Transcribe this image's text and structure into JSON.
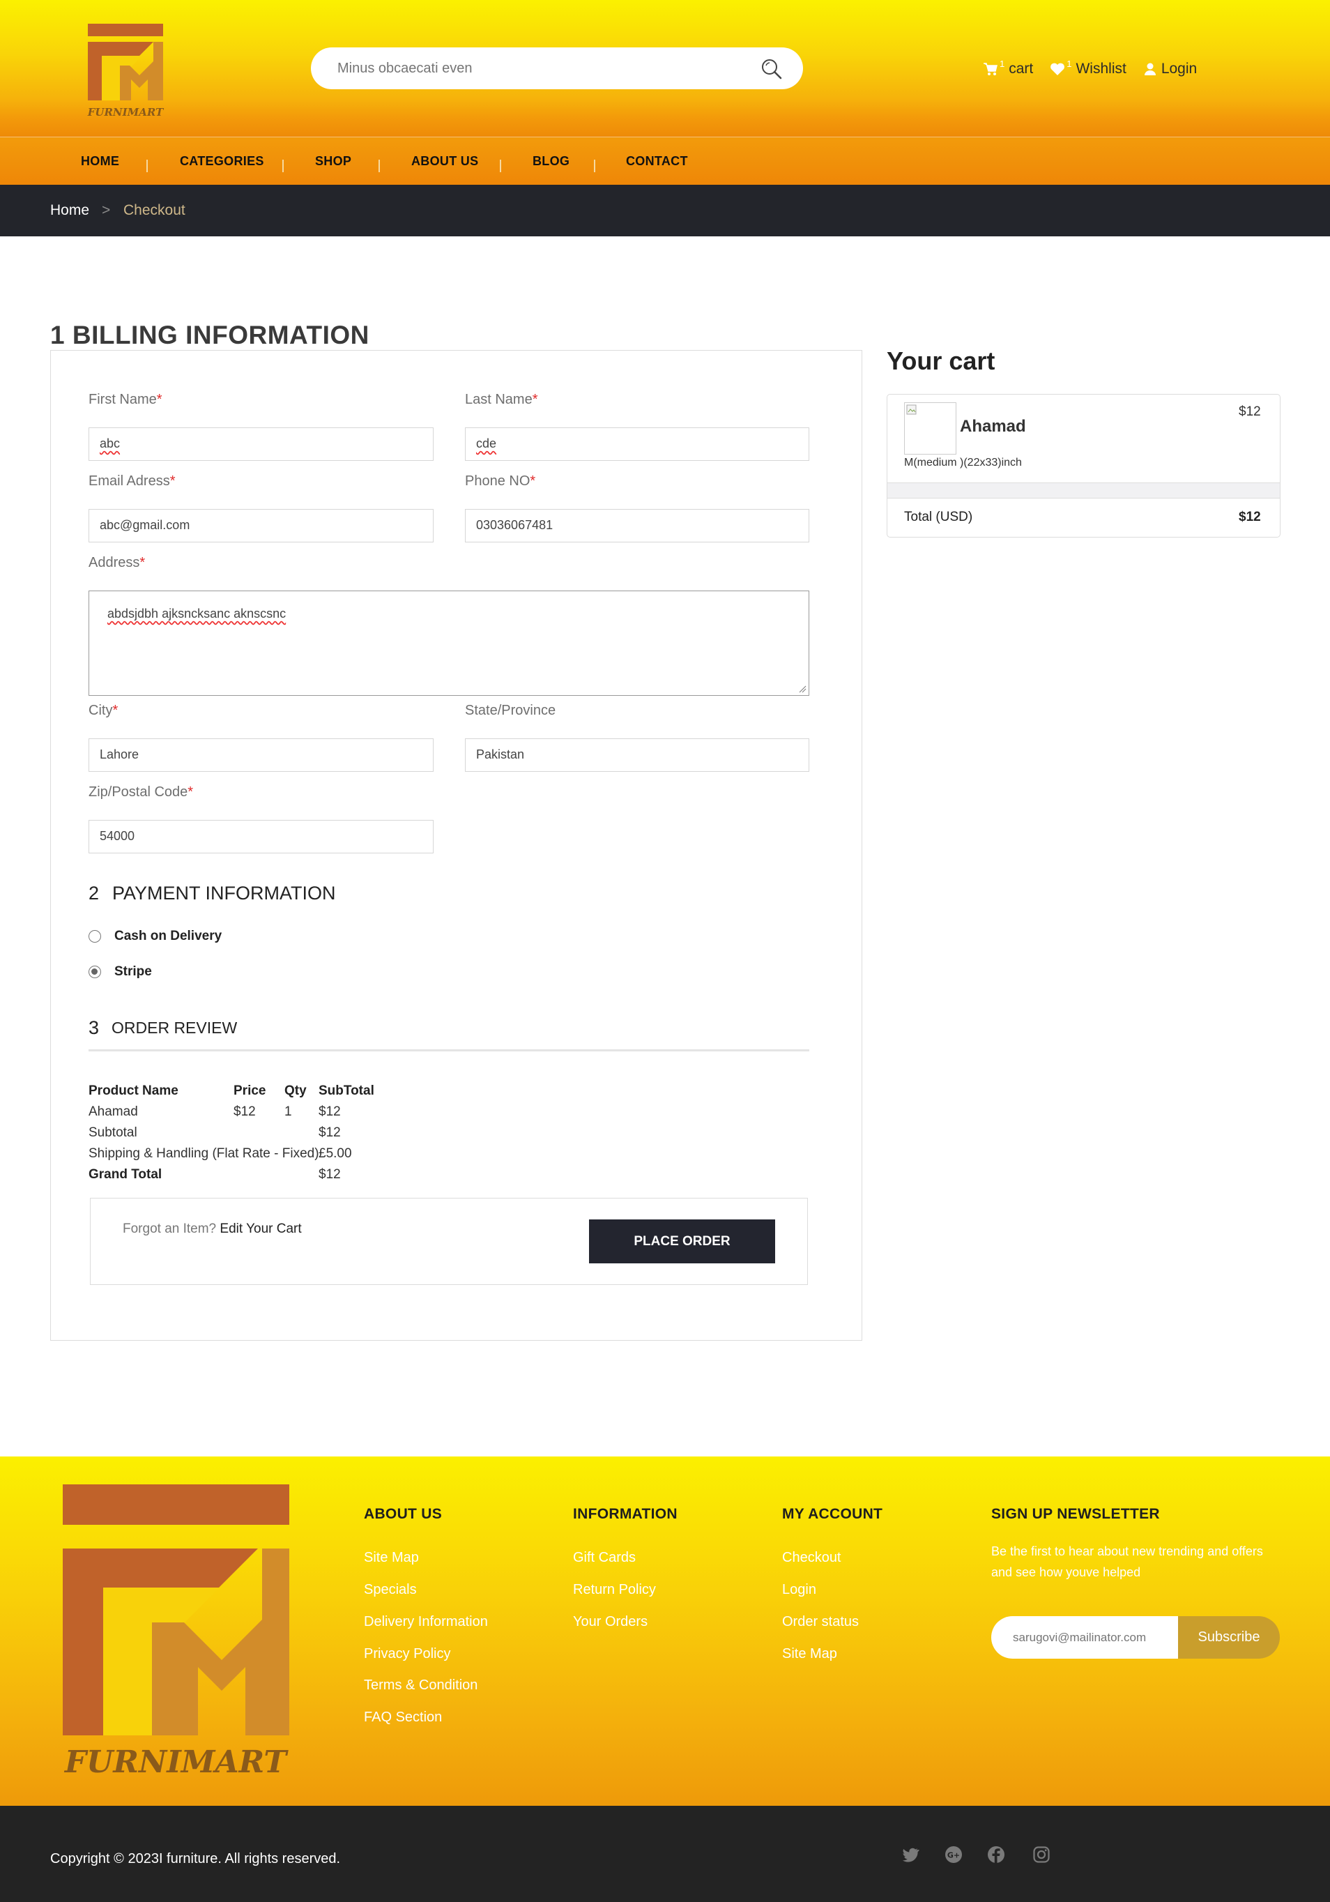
{
  "brand": {
    "name": "FURNIMART",
    "colors": {
      "accent_yellow": "#fbf100",
      "accent_orange": "#ef8708",
      "logo_brown": "#c0622a",
      "logo_gold": "#d28c2a",
      "dark": "#23252b"
    }
  },
  "header": {
    "search": {
      "placeholder": "Minus obcaecati even",
      "icon": "search-icon"
    },
    "cart": {
      "label": "cart",
      "count": "1"
    },
    "wishlist": {
      "label": "Wishlist",
      "count": "1"
    },
    "login": {
      "label": "Login"
    }
  },
  "nav": {
    "items": [
      "HOME",
      "CATEGORIES",
      "SHOP",
      "ABOUT US",
      "BLOG",
      "CONTACT"
    ]
  },
  "breadcrumb": {
    "home": "Home",
    "sep": ">",
    "current": "Checkout"
  },
  "billing": {
    "title": "1 BILLING INFORMATION",
    "required_mark": "*",
    "fields": {
      "first_name": {
        "label": "First Name",
        "value": "abc"
      },
      "last_name": {
        "label": "Last Name",
        "value": "cde"
      },
      "email": {
        "label": "Email Adress",
        "value": "abc@gmail.com"
      },
      "phone": {
        "label": "Phone NO",
        "value": "03036067481"
      },
      "address": {
        "label": "Address",
        "value": "abdsjdbh ajksncksanc aknscsnc"
      },
      "city": {
        "label": "City",
        "value": "Lahore"
      },
      "state": {
        "label": "State/Province",
        "value": "Pakistan"
      },
      "zip": {
        "label": "Zip/Postal Code",
        "value": "54000"
      }
    }
  },
  "payment": {
    "num": "2",
    "title": "PAYMENT INFORMATION",
    "options": [
      {
        "label": "Cash on Delivery",
        "selected": false
      },
      {
        "label": "Stripe",
        "selected": true
      }
    ]
  },
  "review": {
    "num": "3",
    "title": "ORDER REVIEW",
    "headers": [
      "Product Name",
      "Price",
      "Qty",
      "SubTotal"
    ],
    "row": {
      "name": "Ahamad",
      "price": "$12",
      "qty": "1",
      "subtotal": "$12"
    },
    "subtotal_label": "Subtotal",
    "subtotal_value": "$12",
    "shipping_label": "Shipping & Handling (Flat Rate - Fixed)",
    "shipping_value": "£5.00",
    "grand_label": "Grand Total",
    "grand_value": "$12",
    "forgot_text": "Forgot an Item?",
    "edit_cart": "Edit Your Cart",
    "place_order": "PLACE ORDER"
  },
  "cart": {
    "title": "Your cart",
    "item": {
      "name": "Ahamad",
      "price": "$12",
      "variant": "M(medium )(22x33)inch"
    },
    "total_label": "Total (USD)",
    "total_value": "$12"
  },
  "footer": {
    "about": {
      "title": "ABOUT US",
      "links": [
        "Site Map",
        "Specials",
        "Delivery Information",
        "Privacy Policy",
        "Terms & Condition",
        "FAQ Section"
      ]
    },
    "information": {
      "title": "INFORMATION",
      "links": [
        "Gift Cards",
        "Return Policy",
        "Your Orders"
      ]
    },
    "account": {
      "title": "MY ACCOUNT",
      "links": [
        "Checkout",
        "Login",
        "Order status",
        "Site Map"
      ]
    },
    "newsletter": {
      "title": "SIGN UP NEWSLETTER",
      "text": "Be the first to hear about new trending and offers and see how youve helped",
      "placeholder": "sarugovi@mailinator.com",
      "button": "Subscribe"
    },
    "copyright": "Copyright © 2023I furniture. All rights reserved.",
    "social_icons": [
      "twitter-icon",
      "google-plus-icon",
      "facebook-icon",
      "instagram-icon"
    ]
  }
}
